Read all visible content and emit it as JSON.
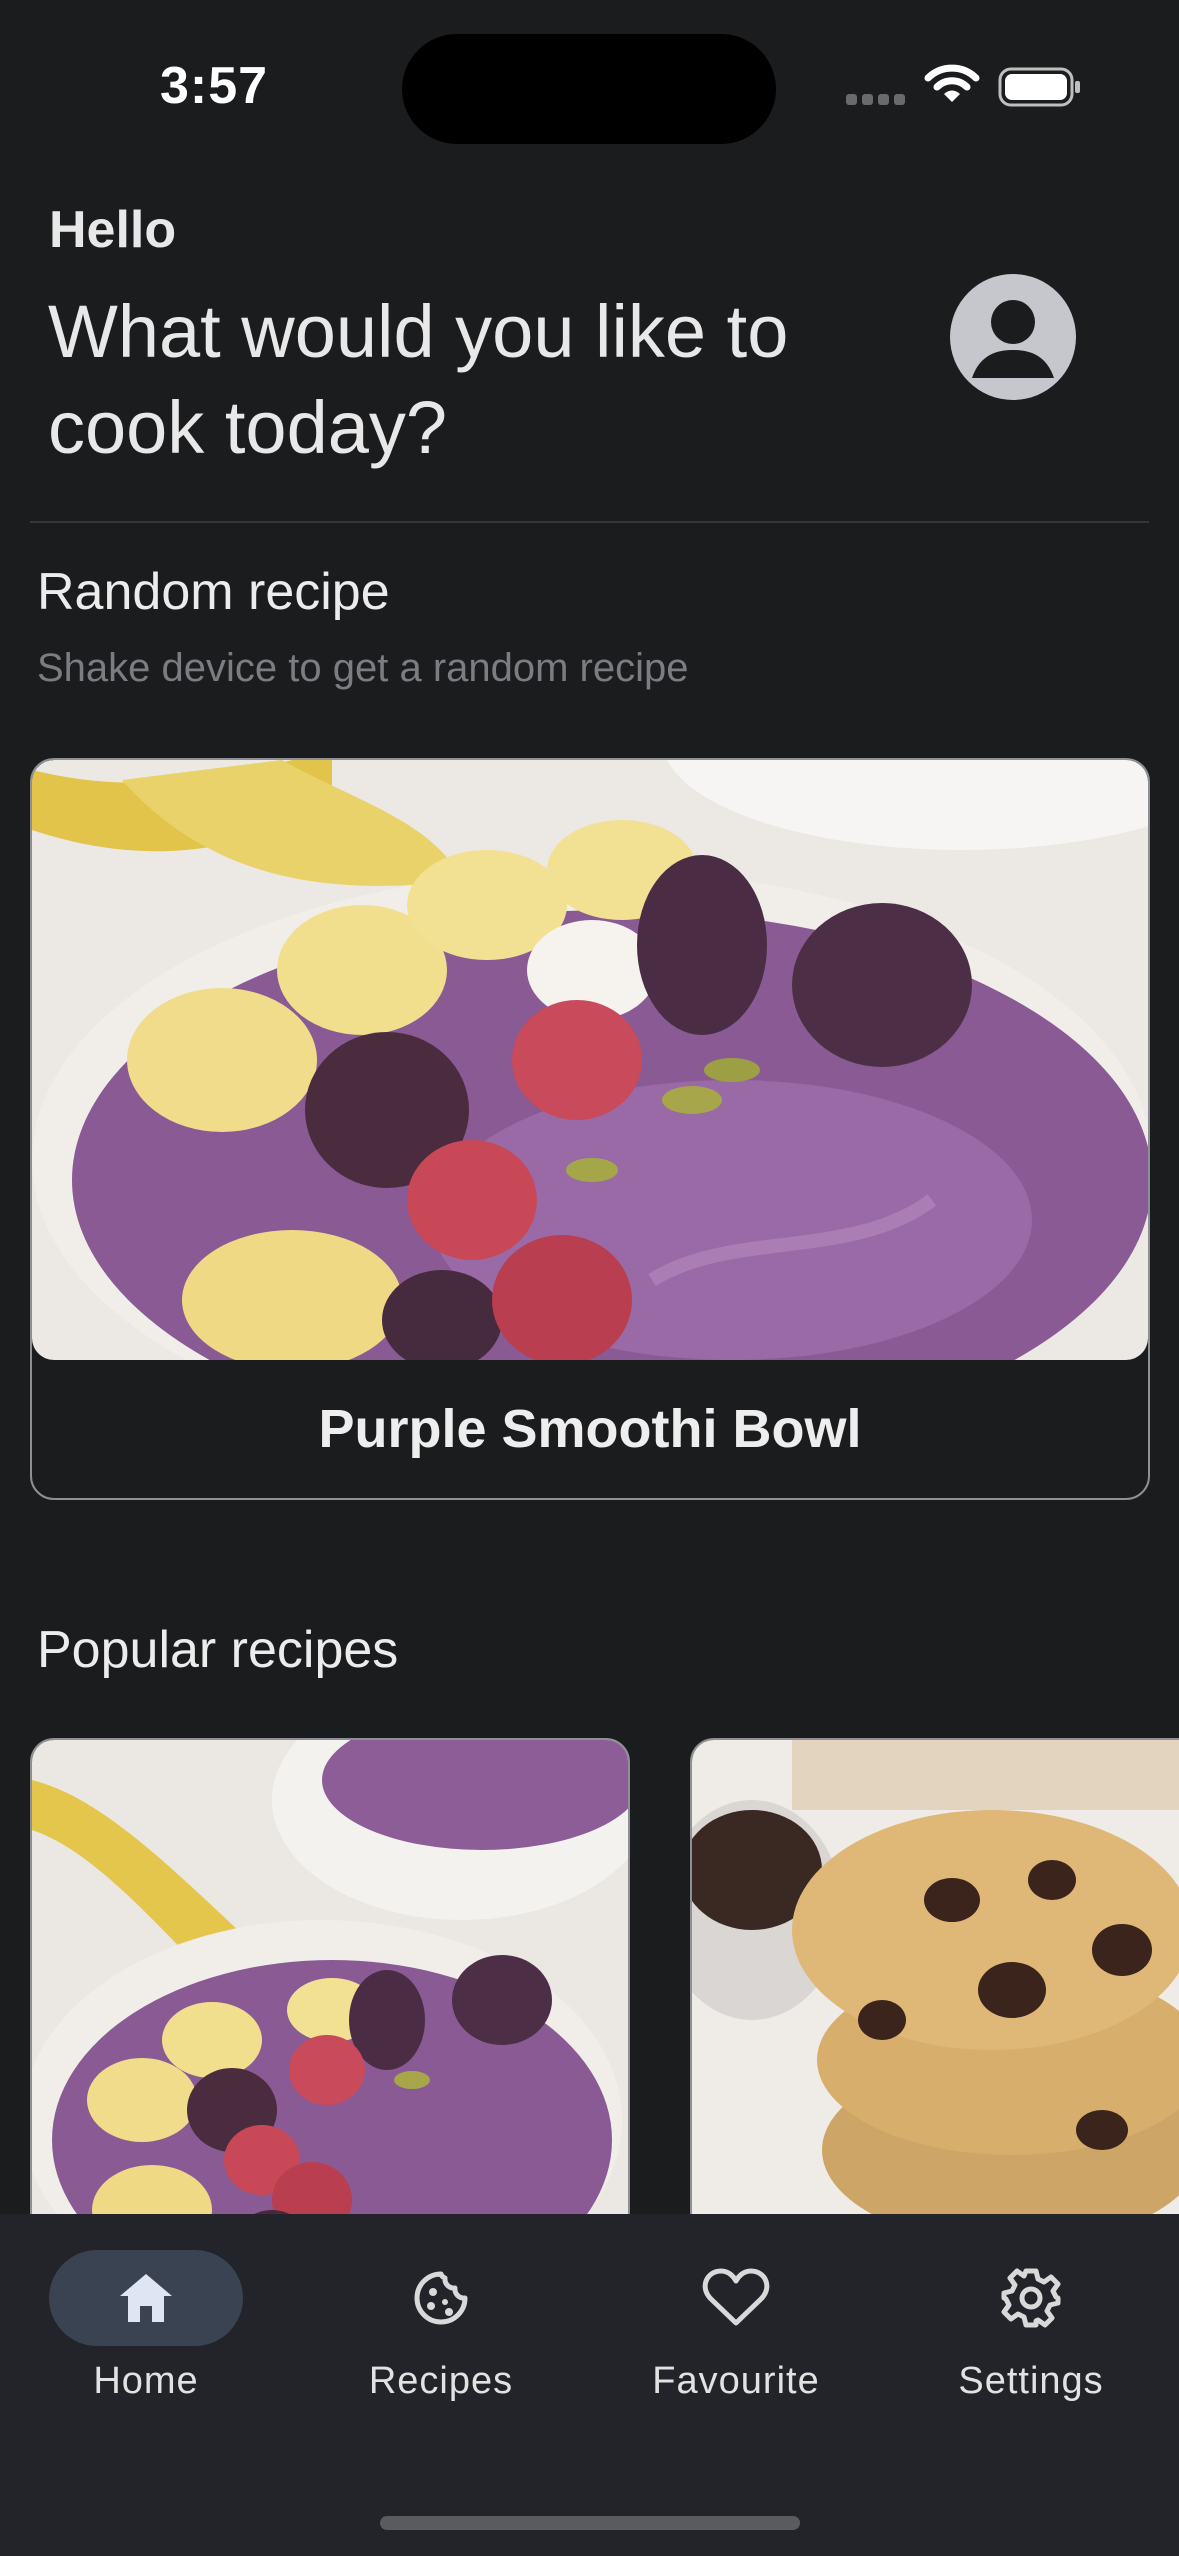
{
  "status_bar": {
    "time": "3:57"
  },
  "header": {
    "greeting": "Hello",
    "question": "What would you like to cook today?"
  },
  "random_recipe": {
    "title": "Random recipe",
    "subtitle": "Shake device to get a random recipe",
    "recipe_name": "Purple Smoothi Bowl"
  },
  "popular": {
    "title": "Popular recipes",
    "cards": [
      {
        "image": "smoothie-bowl-photo"
      },
      {
        "image": "chocolate-chip-cookies-photo"
      }
    ]
  },
  "bottom_nav": {
    "items": [
      {
        "label": "Home",
        "icon": "home-icon",
        "active": true
      },
      {
        "label": "Recipes",
        "icon": "cookie-icon",
        "active": false
      },
      {
        "label": "Favourite",
        "icon": "heart-icon",
        "active": false
      },
      {
        "label": "Settings",
        "icon": "gear-icon",
        "active": false
      }
    ]
  },
  "colors": {
    "background": "#1b1c1e",
    "nav_background": "#222429",
    "active_pill": "#394352",
    "card_border": "#8e9096"
  }
}
